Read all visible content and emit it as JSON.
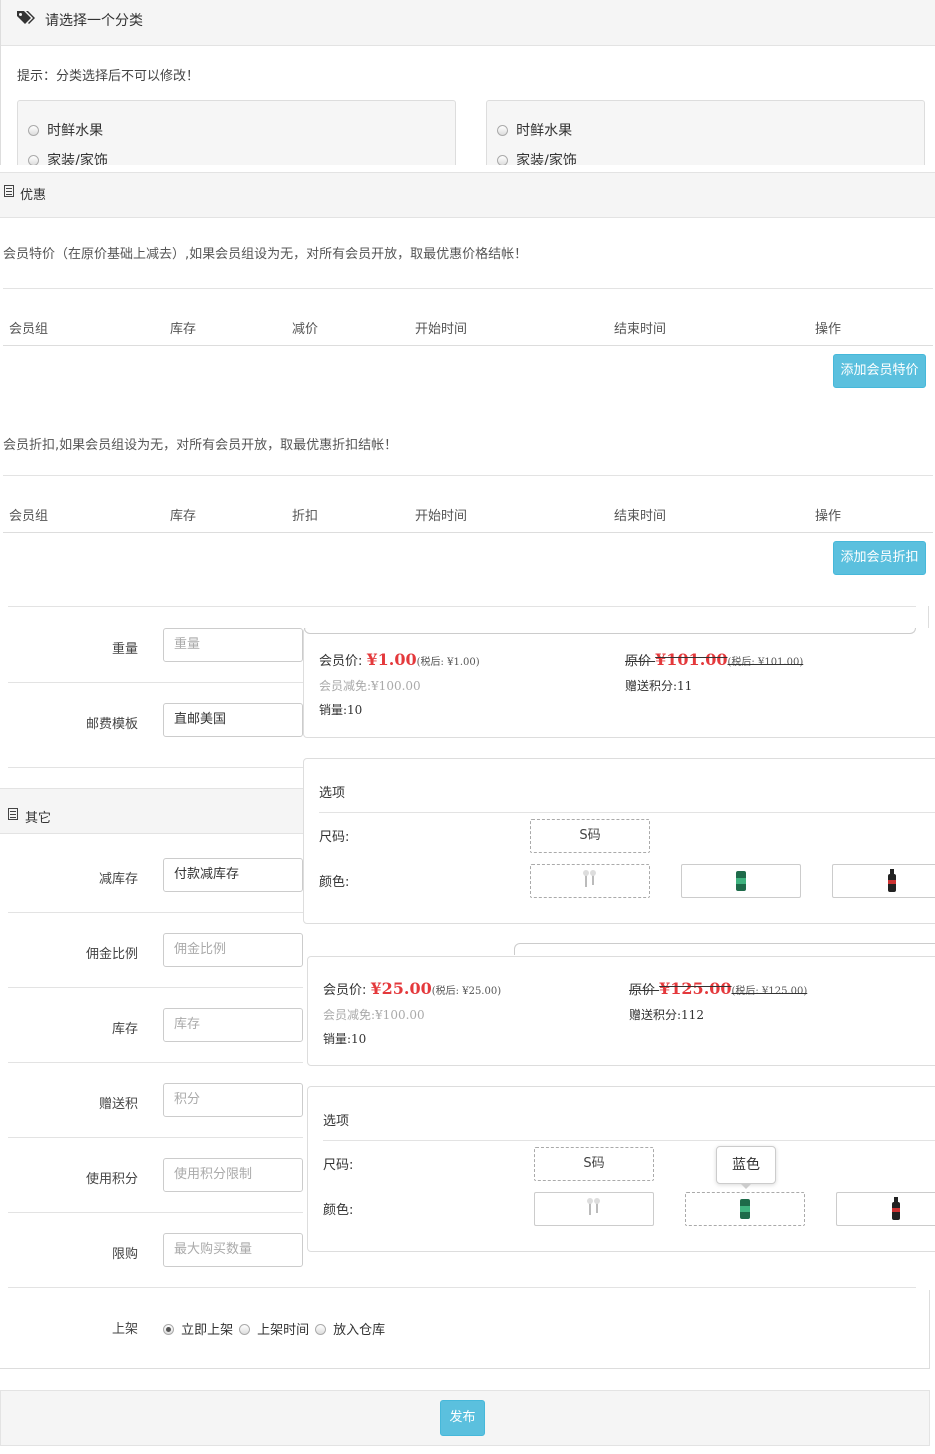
{
  "category": {
    "title": "请选择一个分类",
    "hint": "提示：分类选择后不可以修改！",
    "left_options": [
      "时鲜水果",
      "家装/家饰"
    ],
    "right_options": [
      "时鲜水果",
      "家装/家饰"
    ]
  },
  "discount": {
    "title": "优惠",
    "special_note": "会员特价（在原价基础上减去）,如果会员组设为无，对所有会员开放，取最优惠价格结帐！",
    "special_headers": [
      "会员组",
      "库存",
      "减价",
      "开始时间",
      "结束时间",
      "操作"
    ],
    "special_button": "添加会员特价",
    "rate_note": "会员折扣,如果会员组设为无，对所有会员开放，取最优惠折扣结帐！",
    "rate_headers": [
      "会员组",
      "库存",
      "折扣",
      "开始时间",
      "结束时间",
      "操作"
    ],
    "rate_button": "添加会员折扣"
  },
  "fields": {
    "weight_label": "重量",
    "weight_placeholder": "重量",
    "shipping_label": "邮费模板",
    "shipping_value": "直邮美国"
  },
  "other": {
    "title": "其它",
    "stock_mode_label": "减库存",
    "stock_mode_value": "付款减库存",
    "commission_label": "佣金比例",
    "commission_placeholder": "佣金比例",
    "stock_label": "库存",
    "stock_placeholder": "库存",
    "points_label": "赠送积",
    "points_placeholder": "积分",
    "use_points_label": "使用积分",
    "use_points_placeholder": "使用积分限制",
    "limit_label": "限购",
    "limit_placeholder": "最大购买数量",
    "shelf_label": "上架",
    "shelf_options": [
      "立即上架",
      "上架时间",
      "放入仓库"
    ],
    "shelf_selected": "立即上架"
  },
  "card1": {
    "member_price_label": "会员价:",
    "member_price": "¥1.00",
    "member_tax": "(税后: ¥1.00)",
    "orig_label": "原价",
    "orig_price": "¥101.00",
    "orig_tax": "(税后: ¥101.00)",
    "reduce": "会员减免:¥100.00",
    "points": "赠送积分:11",
    "sales": "销量:10",
    "options_title": "选项",
    "size_label": "尺码:",
    "size_value": "S码",
    "color_label": "颜色:"
  },
  "card2": {
    "member_price_label": "会员价:",
    "member_price": "¥25.00",
    "member_tax": "(税后: ¥25.00)",
    "orig_label": "原价",
    "orig_price": "¥125.00",
    "orig_tax": "(税后: ¥125.00)",
    "reduce": "会员减免:¥100.00",
    "points": "赠送积分:112",
    "sales": "销量:10",
    "options_title": "选项",
    "size_label": "尺码:",
    "size_value": "S码",
    "color_label": "颜色:",
    "tooltip": "蓝色"
  },
  "publish_button": "发布",
  "colors": {
    "accent": "#5bc0de",
    "price": "#e4393c"
  },
  "icons": [
    "tags-icon",
    "document-icon",
    "earphones-icon",
    "green-can-icon",
    "bottle-icon"
  ]
}
